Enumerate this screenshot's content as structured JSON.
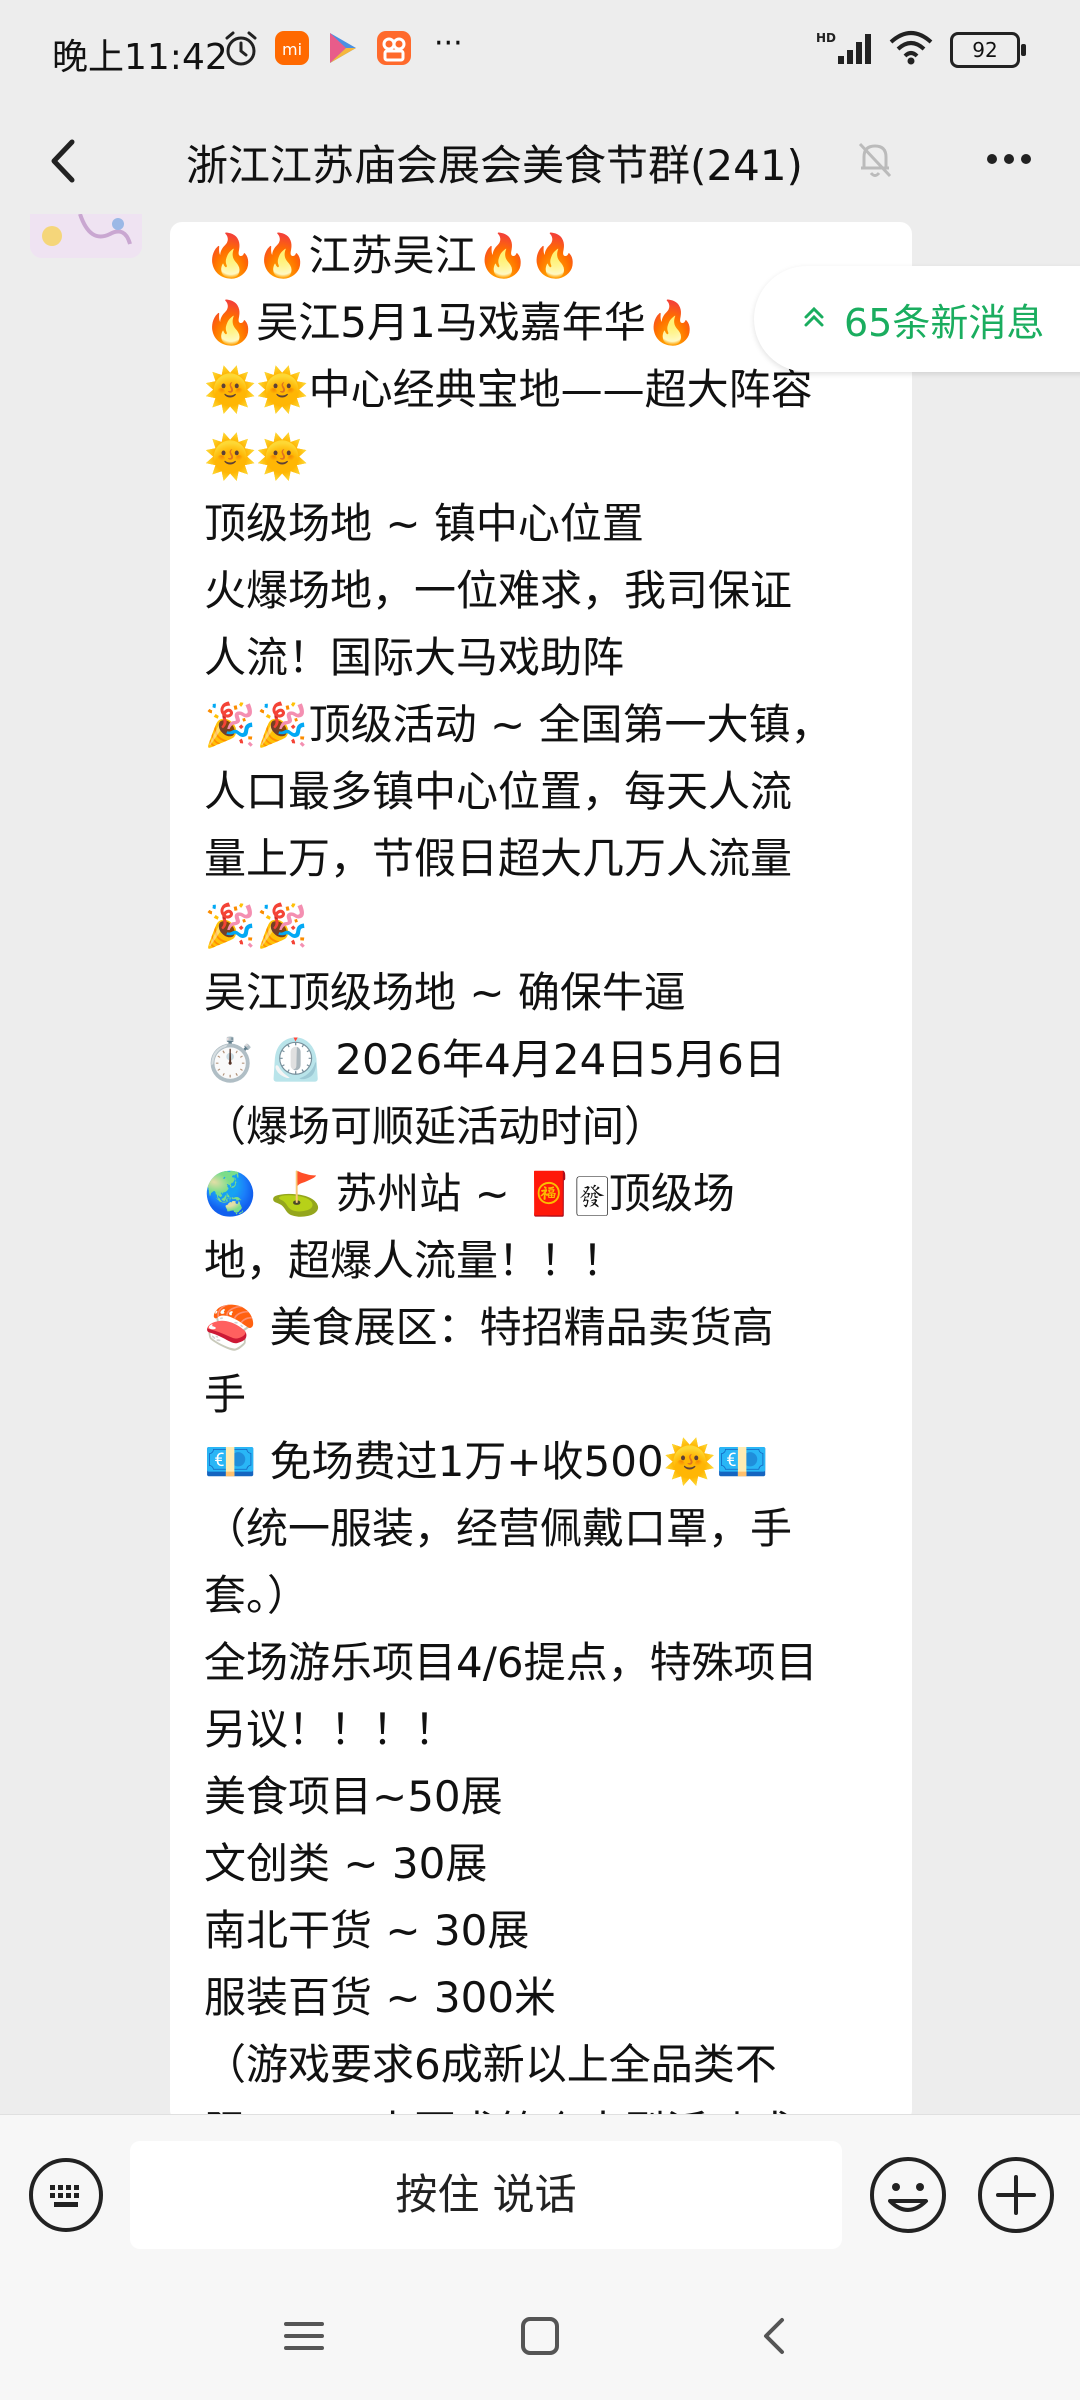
{
  "status_bar": {
    "time": "晚上11:42",
    "network": "HD",
    "battery": "92",
    "more": "···"
  },
  "header": {
    "title": "浙江江苏庙会展会美食节群(241)"
  },
  "new_messages": {
    "label": "65条新消息"
  },
  "message": {
    "lines": [
      "🔥🔥江苏吴江🔥🔥",
      "  🔥吴江5月1马戏嘉年华🔥",
      "🌞🌞中心经典宝地——超大阵容",
      "🌞🌞",
      "顶级场地 ~ 镇中心位置",
      "火爆场地，一位难求，我司保证",
      "人流！国际大马戏助阵",
      "🎉🎉顶级活动 ~ 全国第一大镇，",
      "人口最多镇中心位置，每天人流",
      "量上万，节假日超大几万人流量",
      "🎉🎉",
      "吴江顶级场地 ~ 确保牛逼",
      "⏱️ ⏲️  2026年4月24日5月6日",
      "（爆场可顺延活动时间）",
      "🌏 ⛳  苏州站 ~ 🧧🀅顶级场",
      "地，超爆人流量！！！",
      " 🍣 美食展区：特招精品卖货高",
      "手",
      "💶  免场费过1万+收500🌞💶",
      "（统一服装，经营佩戴口罩，手",
      "套。）",
      "全场游乐项目4/6提点，特殊项目",
      "另议！！！！",
      "美食项目~50展",
      "文创类 ~ 30展",
      "南北干货 ~ 30展",
      "服装百货 ~ 300米",
      " （游戏要求6成新以上全品类不",
      "限！！四电要求简介大型活动或"
    ]
  },
  "input_bar": {
    "voice_label": "按住 说话"
  },
  "icons": {
    "back": "back-arrow-icon",
    "mute": "mute-bell-icon",
    "more": "more-dots-icon",
    "new_msg": "double-chevron-up-icon",
    "keyboard": "keyboard-icon",
    "emoji": "emoji-icon",
    "plus": "plus-icon",
    "menu": "menu-icon",
    "home": "home-square-icon",
    "nav_back": "nav-back-icon"
  },
  "colors": {
    "accent_green": "#1aad5f",
    "background": "#ededed",
    "bubble": "#ffffff"
  }
}
